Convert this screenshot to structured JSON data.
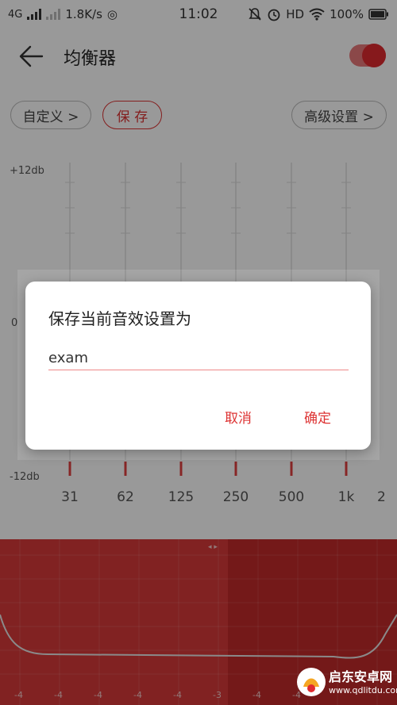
{
  "status_bar": {
    "network": "4G",
    "speed": "1.8K/s",
    "time": "11:02",
    "hd": "HD",
    "battery": "100%",
    "icons": [
      "signal-icon",
      "signal-dim-icon",
      "data-saver-icon",
      "mute-icon",
      "alarm-icon",
      "wifi-icon",
      "battery-icon"
    ]
  },
  "header": {
    "title": "均衡器",
    "back_icon": "back-arrow-icon",
    "toggle_on": true
  },
  "toolbar": {
    "preset_label": "自定义 >",
    "save_label": "保 存",
    "advanced_label": "高级设置 >"
  },
  "eq": {
    "db_max": "+12db",
    "db_zero": "0",
    "db_min": "-12db",
    "frequencies": [
      "31",
      "62",
      "125",
      "250",
      "500",
      "1k",
      "2"
    ]
  },
  "band": {
    "ticks": [
      "-4",
      "-4",
      "-4",
      "-4",
      "-4",
      "-3",
      "-4",
      "-4"
    ]
  },
  "dialog": {
    "title": "保存当前音效设置为",
    "input_value": "exam",
    "cancel_label": "取消",
    "confirm_label": "确定"
  },
  "watermark": {
    "name": "启东安卓网",
    "url": "www.qdlitdu.com"
  },
  "colors": {
    "accent": "#dd3333",
    "band": "#d83a3a",
    "band_dark": "#c12a2a"
  }
}
